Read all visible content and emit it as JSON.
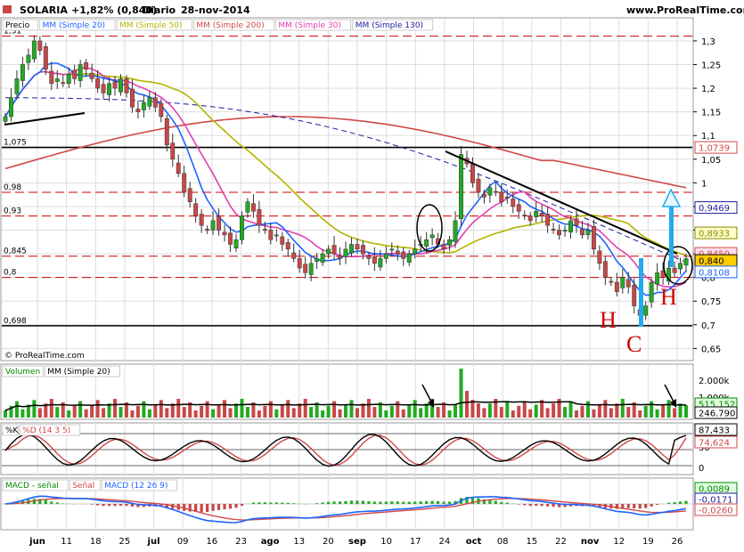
{
  "header": {
    "ticker": "SOLARIA",
    "change": "+1,82% (0,840)",
    "period": "Diario",
    "date": "28-nov-2014",
    "site": "www.ProRealTime.com"
  },
  "watermark": "© ProRealTime.com",
  "price_panel": {
    "legend": [
      "Precio",
      "MM (Simple 20)",
      "MM (Simple 50)",
      "MM (Simple 200)",
      "MM (Simple 30)",
      "MM (Simple 130)"
    ],
    "legend_colors": [
      "#000000",
      "#1e64ff",
      "#b4b400",
      "#d04848",
      "#e040b0",
      "#1a1aa0"
    ],
    "y_ticks": [
      "1,3",
      "1,25",
      "1,2",
      "1,15",
      "1,1",
      "1,05",
      "1",
      "0,95",
      "0,9",
      "0,85",
      "0,8",
      "0,75",
      "0,7",
      "0,65"
    ],
    "y_tick_values": [
      1.3,
      1.25,
      1.2,
      1.15,
      1.1,
      1.05,
      1.0,
      0.95,
      0.9,
      0.85,
      0.8,
      0.75,
      0.7,
      0.65
    ],
    "ylim": [
      0.63,
      1.33
    ],
    "levels": [
      {
        "label": "1,31",
        "value": 1.31,
        "style": "dashed"
      },
      {
        "label": "1,075",
        "value": 1.075,
        "style": "solid"
      },
      {
        "label": "0,98",
        "value": 0.98,
        "style": "dashed"
      },
      {
        "label": "0,93",
        "value": 0.93,
        "style": "dashed"
      },
      {
        "label": "0,845",
        "value": 0.845,
        "style": "dashed"
      },
      {
        "label": "0,8",
        "value": 0.8,
        "style": "dashed"
      },
      {
        "label": "0,698",
        "value": 0.698,
        "style": "solid"
      }
    ],
    "right_tags": [
      {
        "text": "1,0739",
        "value": 1.0739,
        "color": "#d04848",
        "bg": "#ffffff"
      },
      {
        "text": "0,9469",
        "value": 0.9469,
        "color": "#1a1aa0",
        "bg": "#ffffff"
      },
      {
        "text": "0,8933",
        "value": 0.8933,
        "color": "#8a8a00",
        "bg": "#ffffc8"
      },
      {
        "text": "0,8450",
        "value": 0.85,
        "color": "#d04848",
        "bg": "#ffe0f0"
      },
      {
        "text": "0,840",
        "value": 0.835,
        "color": "#000000",
        "bg": "#ffcc00"
      },
      {
        "text": "0,8108",
        "value": 0.8108,
        "color": "#1e64ff",
        "bg": "#ffffff"
      }
    ],
    "pattern_labels": [
      "H",
      "C",
      "H"
    ]
  },
  "volume_panel": {
    "legend": [
      "Volumen",
      "MM (Simple 20)"
    ],
    "legend_colors": [
      "#008800",
      "#000000"
    ],
    "y_ticks": [
      "2.000k",
      "1.000k"
    ],
    "tags": [
      {
        "text": "515.152",
        "color": "#008800",
        "bg": "#e0ffe0"
      },
      {
        "text": "246.790",
        "color": "#000000",
        "bg": "#ffffff"
      }
    ]
  },
  "stoch_panel": {
    "legend": [
      "%K",
      "%D (14 3 5)"
    ],
    "legend_colors": [
      "#000000",
      "#d04848"
    ],
    "y_ticks": [
      "50",
      "0"
    ],
    "tags": [
      {
        "text": "87,433",
        "color": "#000000",
        "bg": "#ffffff"
      },
      {
        "text": "74,624",
        "color": "#d04848",
        "bg": "#ffffff"
      }
    ]
  },
  "macd_panel": {
    "legend": [
      "MACD - señal",
      "Señal",
      "MACD (12 26 9)"
    ],
    "legend_colors": [
      "#008800",
      "#d04848",
      "#1e64ff"
    ],
    "tags": [
      {
        "text": "0,0089",
        "color": "#008800",
        "bg": "#e0ffe0"
      },
      {
        "text": "-0,0171",
        "color": "#1a1aa0",
        "bg": "#ffffff"
      },
      {
        "text": "-0,0260",
        "color": "#d04848",
        "bg": "#ffffff"
      }
    ]
  },
  "x_axis": {
    "labels": [
      "jun",
      "11",
      "18",
      "25",
      "jul",
      "09",
      "16",
      "23",
      "ago",
      "13",
      "20",
      "sep",
      "10",
      "17",
      "24",
      "oct",
      "08",
      "15",
      "22",
      "nov",
      "12",
      "19",
      "26"
    ],
    "bold": [
      "jun",
      "jul",
      "ago",
      "sep",
      "oct",
      "nov"
    ]
  },
  "colors": {
    "up": "#22aa22",
    "down": "#c84848",
    "grid": "#dddddd",
    "level_red": "#cc0000",
    "arrow_blue": "#22aaee"
  },
  "chart_data": {
    "type": "candlestick",
    "title": "SOLARIA",
    "interval": "Diario",
    "date": "28-nov-2014",
    "last_close": 0.84,
    "change_pct": 1.82,
    "closes_approx": [
      1.14,
      1.18,
      1.22,
      1.25,
      1.27,
      1.3,
      1.28,
      1.24,
      1.21,
      1.22,
      1.21,
      1.23,
      1.22,
      1.25,
      1.24,
      1.22,
      1.2,
      1.19,
      1.21,
      1.2,
      1.22,
      1.19,
      1.16,
      1.15,
      1.17,
      1.18,
      1.16,
      1.14,
      1.08,
      1.05,
      1.02,
      0.98,
      0.96,
      0.93,
      0.91,
      0.9,
      0.92,
      0.9,
      0.89,
      0.87,
      0.88,
      0.93,
      0.96,
      0.94,
      0.91,
      0.9,
      0.88,
      0.89,
      0.87,
      0.86,
      0.84,
      0.82,
      0.81,
      0.83,
      0.84,
      0.85,
      0.86,
      0.85,
      0.84,
      0.86,
      0.87,
      0.86,
      0.85,
      0.84,
      0.83,
      0.84,
      0.85,
      0.86,
      0.85,
      0.84,
      0.85,
      0.86,
      0.87,
      0.88,
      0.89,
      0.87,
      0.86,
      0.88,
      0.92,
      1.06,
      1.04,
      1.0,
      0.98,
      0.97,
      0.99,
      0.98,
      0.96,
      0.97,
      0.95,
      0.94,
      0.93,
      0.92,
      0.94,
      0.93,
      0.91,
      0.9,
      0.89,
      0.9,
      0.92,
      0.91,
      0.89,
      0.9,
      0.86,
      0.83,
      0.8,
      0.79,
      0.77,
      0.8,
      0.78,
      0.74,
      0.72,
      0.74,
      0.79,
      0.81,
      0.8,
      0.82,
      0.81,
      0.83,
      0.84
    ],
    "moving_averages": [
      {
        "name": "MM (Simple 20)",
        "last": 0.8108
      },
      {
        "name": "MM (Simple 50)",
        "last": 0.8933
      },
      {
        "name": "MM (Simple 200)",
        "last": 1.0739
      },
      {
        "name": "MM (Simple 30)",
        "last": 0.845
      },
      {
        "name": "MM (Simple 130)",
        "last": 0.9469
      }
    ],
    "horizontal_levels": [
      1.31,
      1.075,
      0.98,
      0.93,
      0.845,
      0.8,
      0.698
    ],
    "annotations": [
      "H",
      "C",
      "H"
    ],
    "volume": {
      "ma20_last": 246790,
      "last": 515152
    },
    "stochastic": {
      "k_last": 87.433,
      "d_last": 74.624
    },
    "macd": {
      "macd_minus_signal": 0.0089,
      "macd_last": -0.0171,
      "signal_last": -0.026
    },
    "ylim": [
      0.63,
      1.33
    ]
  }
}
